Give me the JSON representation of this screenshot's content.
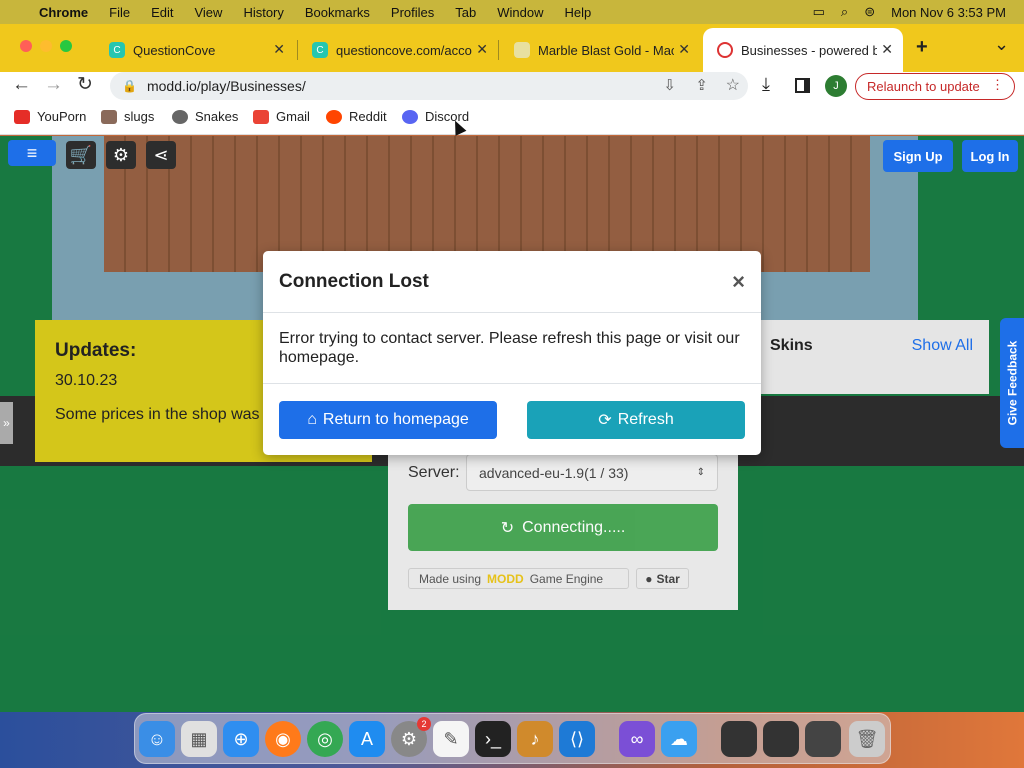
{
  "menubar": {
    "apple": "",
    "app": "Chrome",
    "items": [
      "File",
      "Edit",
      "View",
      "History",
      "Bookmarks",
      "Profiles",
      "Tab",
      "Window",
      "Help"
    ],
    "clock": "Mon Nov 6  3:53 PM"
  },
  "tabs": [
    {
      "title": "QuestionCove",
      "favicon": "C",
      "close": "✕"
    },
    {
      "title": "questioncove.com/acco",
      "favicon": "C",
      "close": "✕"
    },
    {
      "title": "Marble Blast Gold - Mac",
      "favicon": "",
      "close": "✕"
    },
    {
      "title": "Businesses - powered b",
      "favicon": "",
      "close": "✕"
    }
  ],
  "new_tab": "+",
  "tab_list": "⌄",
  "address": {
    "url": "modd.io/play/Businesses/"
  },
  "toolbar": {
    "profile_initial": "J",
    "relaunch": "Relaunch to update"
  },
  "bookmarks": [
    {
      "label": "YouPorn",
      "color": "#e52d27"
    },
    {
      "label": "slugs",
      "color": "#8a6a5a"
    },
    {
      "label": "Snakes",
      "color": "#666666"
    },
    {
      "label": "Gmail",
      "color": "#ea4335"
    },
    {
      "label": "Reddit",
      "color": "#ff4500"
    },
    {
      "label": "Discord",
      "color": "#5865f2"
    }
  ],
  "game": {
    "sign_up": "Sign Up",
    "log_in": "Log In",
    "updates_title": "Updates:",
    "updates_date": "30.10.23",
    "updates_text": "Some prices in the shop was",
    "skins_title": "Skins",
    "skins_show_all": "Show All",
    "server_label": "Server:",
    "server_value": "advanced-eu-1.9(1 / 33)",
    "connecting": "Connecting.....",
    "made_using": "Made using",
    "engine": "Game Engine",
    "star": "Star",
    "feedback": "Give Feedback",
    "side_handle": "»"
  },
  "modal": {
    "title": "Connection Lost",
    "close": "×",
    "message": "Error trying to contact server. Please refresh this page or visit our homepage.",
    "home_button": "Return to homepage",
    "refresh_button": "Refresh"
  },
  "dock": {
    "badge": "2"
  },
  "colors": {
    "primary": "#1e6fe8",
    "info": "#1aa2b8",
    "success": "#2e9a3c",
    "tabbar": "#f0c81c"
  }
}
